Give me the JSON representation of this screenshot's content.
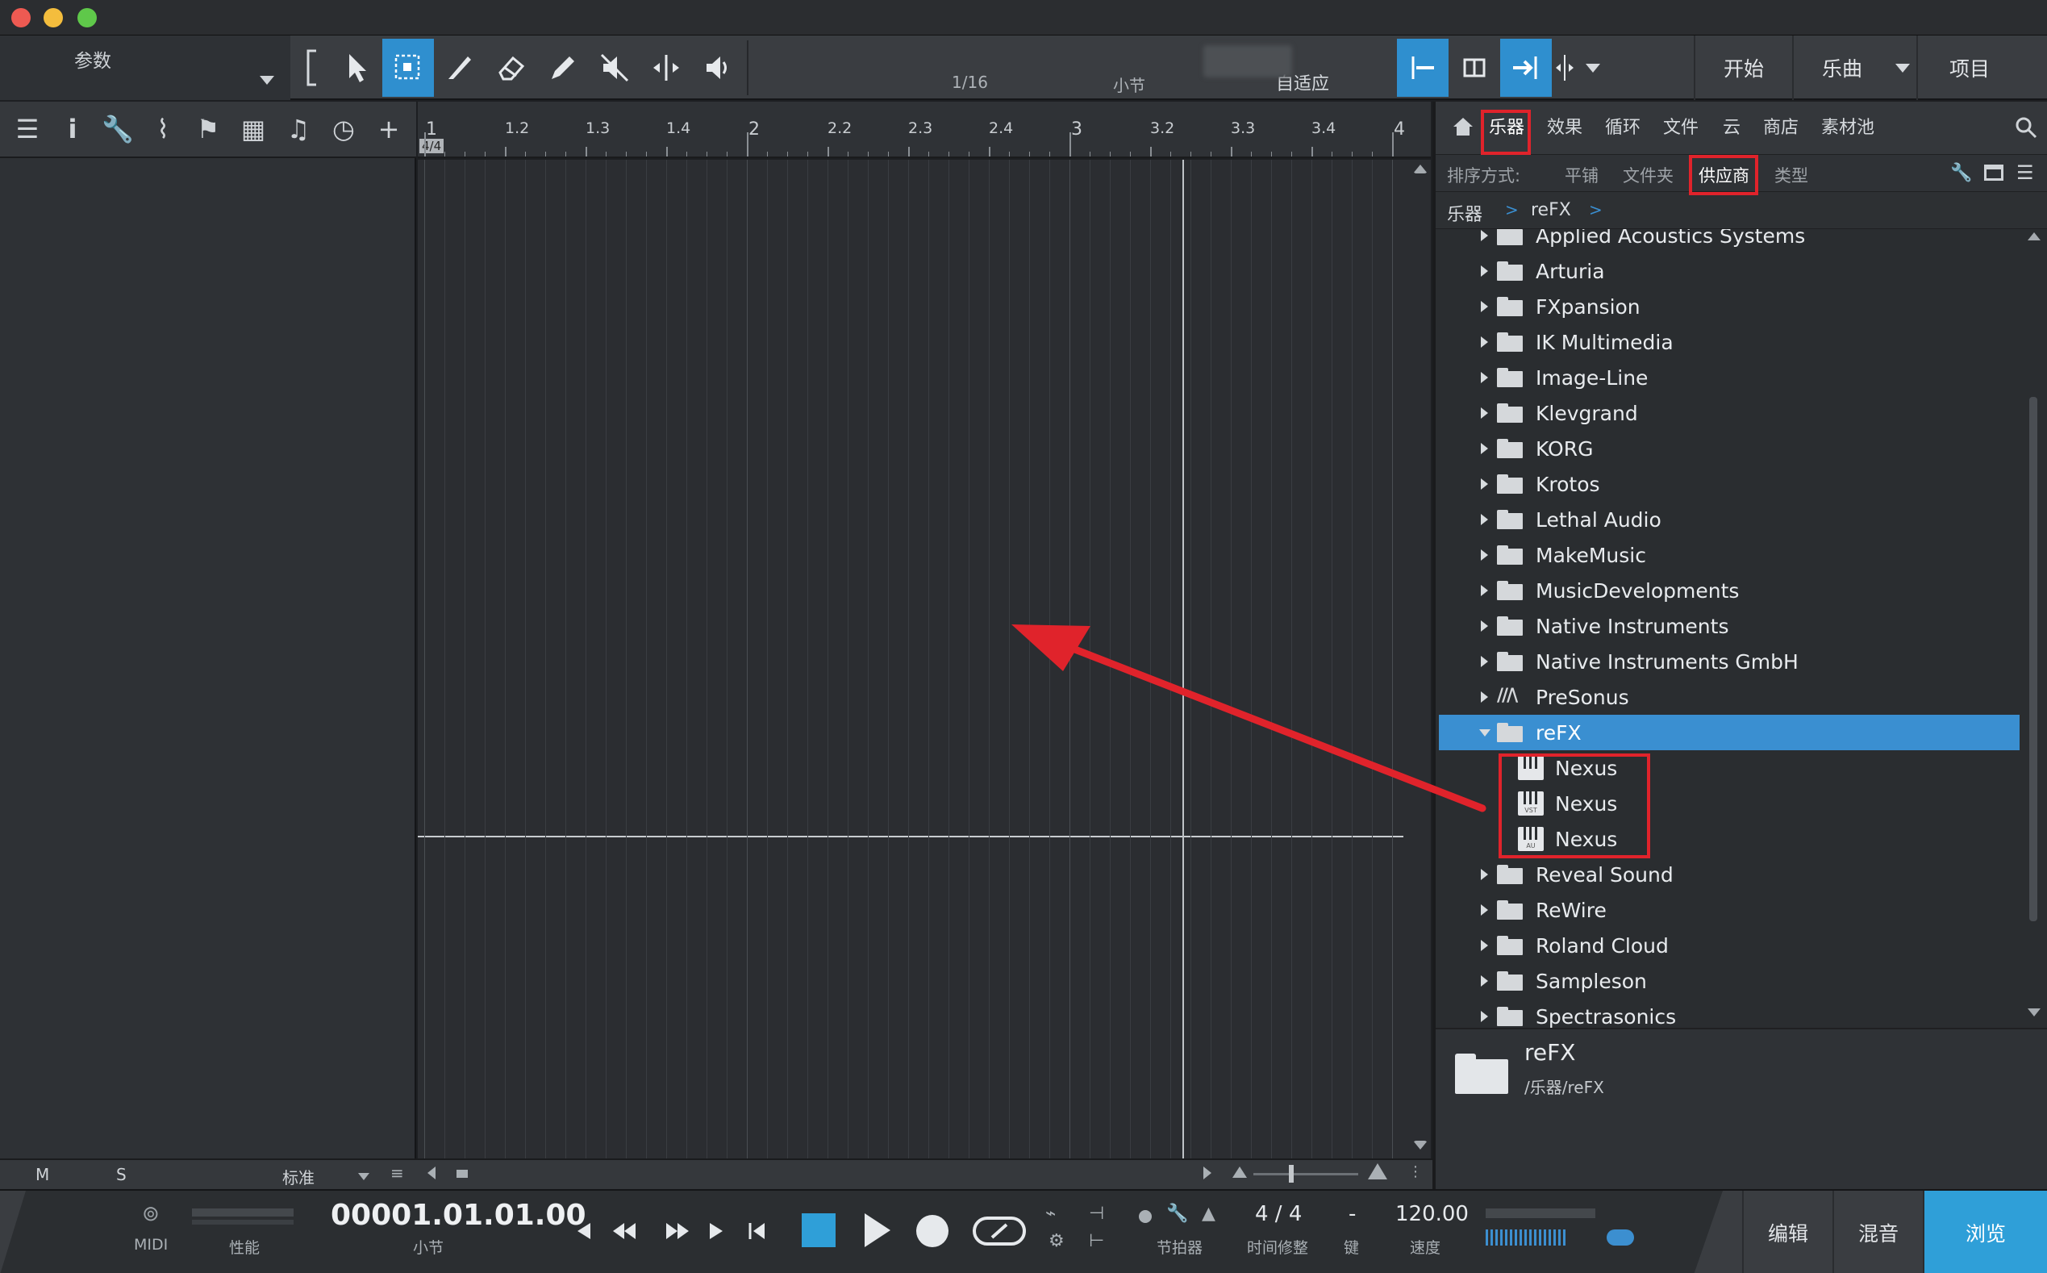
{
  "toolbar": {
    "params_label": "参数",
    "quantize_value": "1/16",
    "timebase_value": "小节",
    "snap_value": "自适应",
    "start_label": "开始",
    "song_label": "乐曲",
    "project_label": "项目"
  },
  "ruler": {
    "time_signature": "4/4",
    "labels": [
      "1",
      "1.2",
      "1.3",
      "1.4",
      "2",
      "2.2",
      "2.3",
      "2.4",
      "3",
      "3.2",
      "3.3",
      "3.4",
      "4"
    ]
  },
  "track_footer": {
    "mute_label": "M",
    "solo_label": "S",
    "preset_label": "标准"
  },
  "browser": {
    "tabs": [
      "乐器",
      "效果",
      "循环",
      "文件",
      "云",
      "商店",
      "素材池"
    ],
    "active_tab": "乐器",
    "sort_label": "排序方式:",
    "sort_options": [
      "平铺",
      "文件夹",
      "供应商",
      "类型"
    ],
    "active_sort": "供应商",
    "breadcrumb": [
      "乐器",
      "reFX"
    ],
    "vendors": [
      {
        "label": "Applied Acoustics Systems",
        "icon": "folder-icon"
      },
      {
        "label": "Arturia",
        "icon": "folder-icon"
      },
      {
        "label": "FXpansion",
        "icon": "folder-icon"
      },
      {
        "label": "IK Multimedia",
        "icon": "folder-icon"
      },
      {
        "label": "Image-Line",
        "icon": "folder-icon"
      },
      {
        "label": "Klevgrand",
        "icon": "folder-icon"
      },
      {
        "label": "KORG",
        "icon": "folder-icon"
      },
      {
        "label": "Krotos",
        "icon": "folder-icon"
      },
      {
        "label": "Lethal Audio",
        "icon": "folder-icon"
      },
      {
        "label": "MakeMusic",
        "icon": "folder-icon"
      },
      {
        "label": "MusicDevelopments",
        "icon": "folder-icon"
      },
      {
        "label": "Native Instruments",
        "icon": "folder-icon"
      },
      {
        "label": "Native Instruments GmbH",
        "icon": "folder-icon"
      },
      {
        "label": "PreSonus",
        "icon": "presonus-logo-icon"
      }
    ],
    "selected_vendor": "reFX",
    "plugins": [
      {
        "label": "Nexus",
        "badge": ""
      },
      {
        "label": "Nexus",
        "badge": "VST"
      },
      {
        "label": "Nexus",
        "badge": "AU"
      }
    ],
    "vendors_after": [
      {
        "label": "Reveal Sound"
      },
      {
        "label": "ReWire"
      },
      {
        "label": "Roland Cloud"
      },
      {
        "label": "Sampleson"
      },
      {
        "label": "Spectrasonics"
      }
    ],
    "info_title": "reFX",
    "info_path": "/乐器/reFX"
  },
  "transport": {
    "midi_label": "MIDI",
    "performance_label": "性能",
    "position": "00001.01.01.00",
    "position_unit": "小节",
    "metronome_label": "节拍器",
    "time_signature": "4 / 4",
    "time_signature_label": "时间修整",
    "key_value": "-",
    "key_label": "键",
    "tempo_value": "120.00",
    "tempo_label": "速度",
    "edit_label": "编辑",
    "mix_label": "混音",
    "browse_label": "浏览"
  },
  "colors": {
    "accent": "#2f8fcf",
    "selection": "#3a8fd1",
    "highlight_box": "#e0232b",
    "annotation_arrow": "#e0232b"
  }
}
